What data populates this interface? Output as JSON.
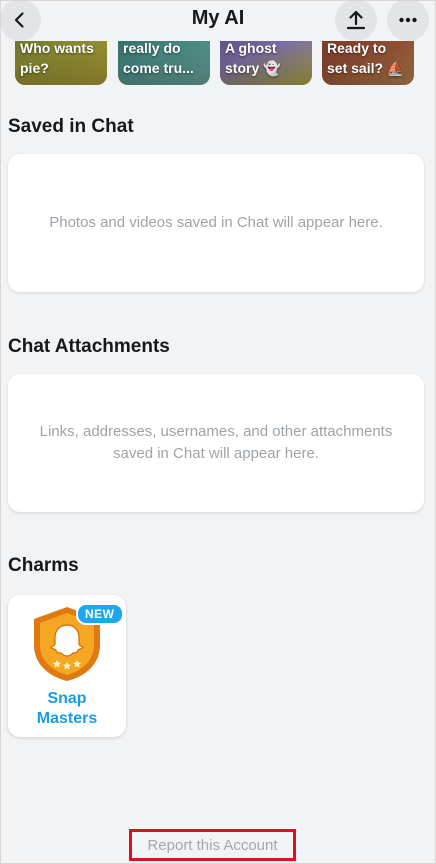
{
  "header": {
    "title": "My AI",
    "back_icon": "chevron-left-icon",
    "share_icon": "share-upload-icon",
    "more_icon": "more-horizontal-icon"
  },
  "story_tiles": [
    {
      "text": "Who wants\npie?"
    },
    {
      "text": "really do\ncome tru..."
    },
    {
      "text": "A ghost\nstory 👻"
    },
    {
      "text": "Ready to\nset sail? ⛵"
    }
  ],
  "saved_in_chat": {
    "title": "Saved in Chat",
    "empty_text": "Photos and videos saved in Chat will appear here."
  },
  "chat_attachments": {
    "title": "Chat Attachments",
    "empty_text": "Links, addresses, usernames, and other attachments saved in Chat will appear here."
  },
  "charms": {
    "title": "Charms",
    "items": [
      {
        "name": "Snap\nMasters",
        "badge": "NEW",
        "icon": "ghost-shield-icon"
      }
    ]
  },
  "footer": {
    "report_label": "Report this Account"
  },
  "colors": {
    "background": "#f2f3f5",
    "accent_blue": "#1a9be6",
    "highlight_red": "#e00f1e",
    "badge_orange": "#f39a1e"
  }
}
